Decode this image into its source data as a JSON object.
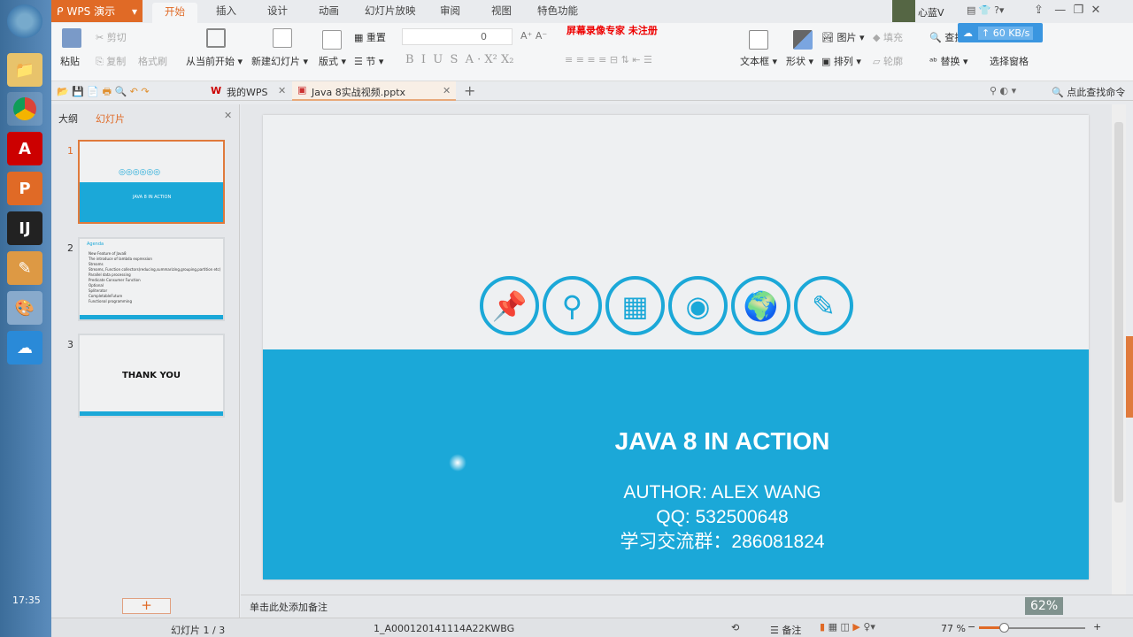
{
  "app": {
    "brand": "WPS 演示",
    "accent": "#e06a26",
    "slide_blue": "#1ba8d8"
  },
  "menu_tabs": [
    "开始",
    "插入",
    "设计",
    "动画",
    "幻灯片放映",
    "审阅",
    "视图",
    "特色功能"
  ],
  "user": {
    "name": "心蓝V"
  },
  "watermark": "屏幕录像专家 未注册",
  "net_speed": "60 KB/s",
  "ribbon": {
    "paste": "粘贴",
    "cut": "剪切",
    "copy": "复制",
    "format_painter": "格式刷",
    "from_current": "从当前开始",
    "new_slide": "新建幻灯片",
    "layout": "版式",
    "reset": "重置",
    "section": "节",
    "font_size": "0",
    "textbox": "文本框",
    "shape": "形状",
    "picture": "图片",
    "fill": "填充",
    "arrange": "排列",
    "outline": "轮廓",
    "find": "查找",
    "replace": "替换",
    "select_pane": "选择窗格"
  },
  "doc_tabs": [
    {
      "label": "我的WPS"
    },
    {
      "label": "Java 8实战视频.pptx"
    }
  ],
  "find_command": "点此查找命令",
  "panel": {
    "tab_outline": "大纲",
    "tab_slides": "幻灯片"
  },
  "thumbs": [
    {
      "num": "1",
      "title": "JAVA 8 IN ACTION"
    },
    {
      "num": "2",
      "title": "Agenda",
      "items": [
        "New Feature of Java8",
        "The introduce of lambda expression",
        "Streams",
        "Streams, Function collectors(reducing,summarizing,grouping,partition etc)",
        "Parallel data processing",
        "Predicate Consumer Function",
        "Optional",
        "Spliterator",
        "CompletableFuture",
        "Functional programming"
      ]
    },
    {
      "num": "3",
      "title": "THANK YOU"
    }
  ],
  "slide": {
    "title": "JAVA 8 IN ACTION",
    "author": "AUTHOR: ALEX WANG",
    "qq": "QQ: 532500648",
    "group": "学习交流群：286081824"
  },
  "notes_placeholder": "单击此处添加备注",
  "status": {
    "slide_pos": "幻灯片 1 / 3",
    "template": "1_A000120141114A22KWBG",
    "notes": "备注",
    "zoom": "77 %",
    "zoom_percent": 77
  },
  "taskbar": {
    "clock": "17:35",
    "battery": "62%"
  }
}
